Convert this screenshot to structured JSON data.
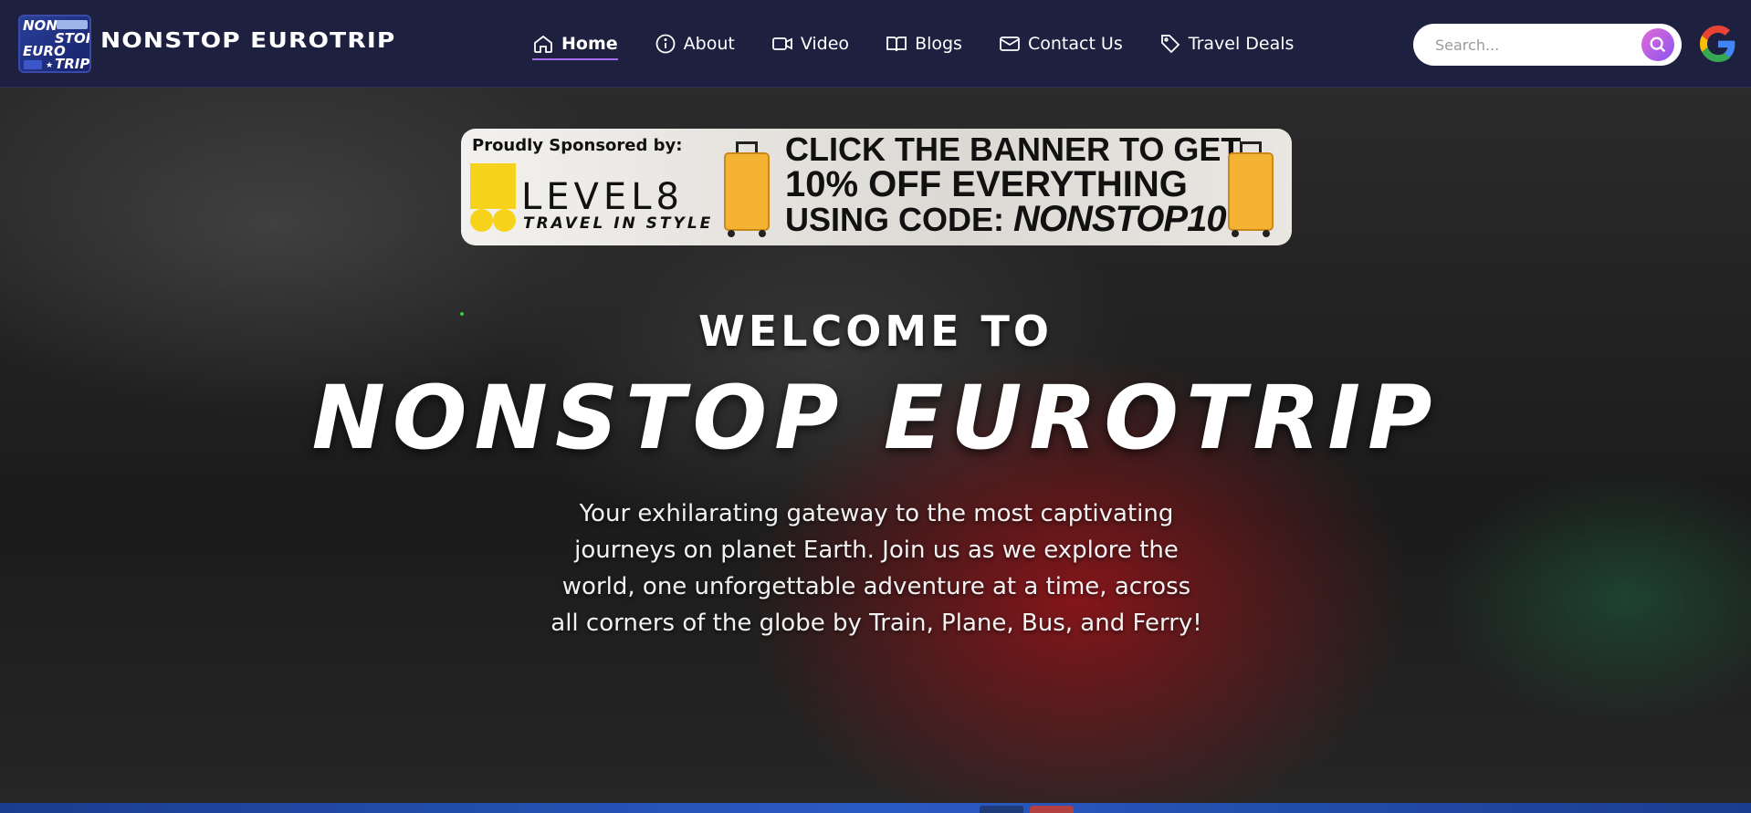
{
  "header": {
    "logo_lines": [
      "NON",
      "STOP",
      "EURO",
      "TRIP"
    ],
    "brand": "NONSTOP EUROTRIP"
  },
  "nav": {
    "items": [
      {
        "label": "Home",
        "icon": "home-icon",
        "active": true
      },
      {
        "label": "About",
        "icon": "info-icon",
        "active": false
      },
      {
        "label": "Video",
        "icon": "video-camera-icon",
        "active": false
      },
      {
        "label": "Blogs",
        "icon": "book-open-icon",
        "active": false
      },
      {
        "label": "Contact Us",
        "icon": "mail-icon",
        "active": false
      },
      {
        "label": "Travel Deals",
        "icon": "tag-icon",
        "active": false
      }
    ]
  },
  "search": {
    "placeholder": "Search...",
    "button_icon": "search-icon"
  },
  "google_icon": "google-icon",
  "banner": {
    "sponsor_text": "Proudly Sponsored by:",
    "brand": "LEVEL8",
    "brand_tagline": "TRAVEL IN STYLE",
    "promo_line1": "CLICK THE BANNER TO GET",
    "promo_line2": "10% OFF EVERYTHING",
    "promo_line3_prefix": "USING CODE: ",
    "promo_code": "NONSTOP10"
  },
  "hero": {
    "welcome": "WELCOME TO",
    "title": "NONSTOP EUROTRIP",
    "tagline": "Your exhilarating gateway to the most captivating journeys on planet Earth. Join us as we explore the world, one unforgettable adventure at a time, across all corners of the globe by Train, Plane, Bus, and Ferry!"
  },
  "colors": {
    "header_bg": "#1e2040",
    "accent": "#a86cf0",
    "search_button": "#c060e0",
    "banner_yellow": "#f7d21a"
  }
}
